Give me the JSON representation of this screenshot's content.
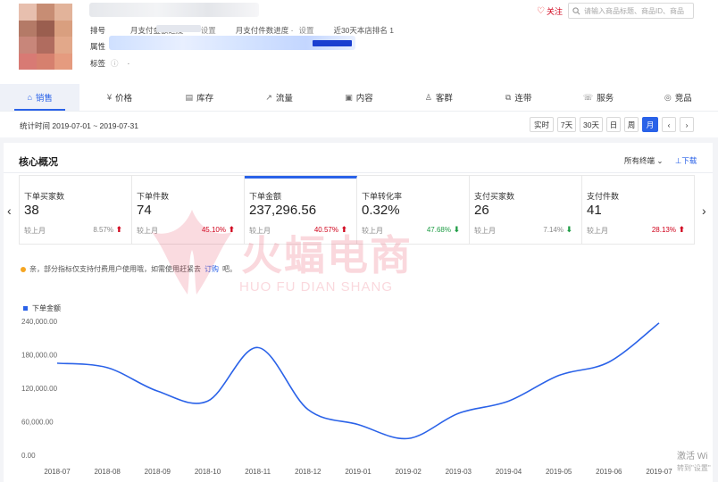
{
  "header": {
    "follow_label": "关注",
    "search_placeholder": "请输入商品标题、商品ID、商品",
    "row1": [
      {
        "key": "排号",
        "value": "月支付金额进度 ·"
      },
      {
        "key": "",
        "value": "设置"
      },
      {
        "key": "",
        "value": "月支付件数进度 ·"
      },
      {
        "key": "",
        "value": "设置"
      },
      {
        "key": "",
        "value": "近30天本店排名 1"
      }
    ],
    "attr_label": "属性",
    "tag_label": "标签",
    "tag_value": "·"
  },
  "tabs": [
    {
      "label": "销售",
      "icon": "⌂",
      "active": true
    },
    {
      "label": "价格",
      "icon": "¥",
      "active": false
    },
    {
      "label": "库存",
      "icon": "▤",
      "active": false
    },
    {
      "label": "流量",
      "icon": "↗",
      "active": false
    },
    {
      "label": "内容",
      "icon": "▣",
      "active": false
    },
    {
      "label": "客群",
      "icon": "♙",
      "active": false
    },
    {
      "label": "连带",
      "icon": "⧉",
      "active": false
    },
    {
      "label": "服务",
      "icon": "☏",
      "active": false
    },
    {
      "label": "竞品",
      "icon": "◎",
      "active": false
    }
  ],
  "datebar": {
    "label": "统计时间 2019-07-01 ~ 2019-07-31",
    "periods": [
      "实时",
      "7天",
      "30天",
      "日",
      "周",
      "月"
    ],
    "active_period": "月",
    "prev": "‹",
    "next": "›"
  },
  "core": {
    "title": "核心概况",
    "all_terminals": "所有终端 ⌄",
    "download": "⊥下载",
    "compare_label": "较上月",
    "metrics": [
      {
        "name": "下单买家数",
        "value": "38",
        "pct": "8.57%",
        "dir": "up",
        "active": false
      },
      {
        "name": "下单件数",
        "value": "74",
        "pct": "45.10%",
        "dir": "up",
        "active": false
      },
      {
        "name": "下单金额",
        "value": "237,296.56",
        "pct": "40.57%",
        "dir": "up",
        "active": true
      },
      {
        "name": "下单转化率",
        "value": "0.32%",
        "pct": "47.68%",
        "dir": "down",
        "active": false
      },
      {
        "name": "支付买家数",
        "value": "26",
        "pct": "7.14%",
        "dir": "down",
        "active": false
      },
      {
        "name": "支付件数",
        "value": "41",
        "pct": "28.13%",
        "dir": "up",
        "active": false
      }
    ],
    "notice_text": "亲，部分指标仅支持付费用户使用哦，如需使用赶紧去",
    "notice_link": "订购",
    "notice_tail": "吧。",
    "left_arrow": "‹",
    "right_arrow": "›"
  },
  "watermark": {
    "big": "火蝠电商",
    "small": "HUO FU DIAN SHANG"
  },
  "windows": {
    "activate": "激活 Wi",
    "activate_hint": "转到\"设置\""
  },
  "chart_data": {
    "type": "line",
    "x": [
      "2018-07",
      "2018-08",
      "2018-09",
      "2018-10",
      "2018-11",
      "2018-12",
      "2019-01",
      "2019-02",
      "2019-03",
      "2019-04",
      "2019-05",
      "2019-06",
      "2019-07"
    ],
    "series": [
      {
        "name": "下单金额",
        "values": [
          165000,
          157000,
          115000,
          97000,
          193000,
          82000,
          55000,
          30000,
          75000,
          97000,
          143000,
          167000,
          237000
        ],
        "color": "#2a62e8"
      }
    ],
    "y_ticks": [
      "0.00",
      "60,000.00",
      "120,000.00",
      "180,000.00",
      "240,000.00"
    ],
    "ylim": [
      0,
      240000
    ],
    "grid": false,
    "legend": "top-left"
  }
}
